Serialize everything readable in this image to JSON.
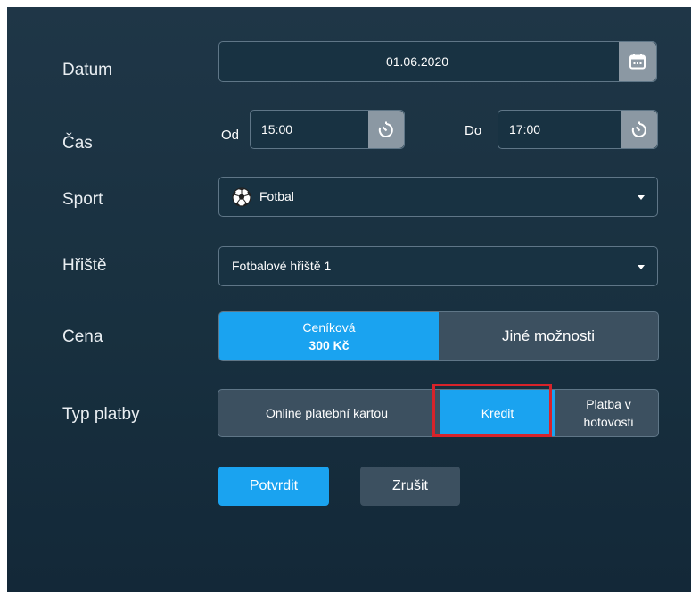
{
  "form": {
    "date": {
      "label": "Datum",
      "value": "01.06.2020",
      "icon": "calendar-icon"
    },
    "time": {
      "label": "Čas",
      "from_label": "Od",
      "from_value": "15:00",
      "to_label": "Do",
      "to_value": "17:00",
      "icon": "timer-icon"
    },
    "sport": {
      "label": "Sport",
      "value": "Fotbal",
      "icon": "soccer-ball-icon"
    },
    "field": {
      "label": "Hřiště",
      "value": "Fotbalové hřiště 1"
    },
    "price": {
      "label": "Cena",
      "options": [
        {
          "line1": "Ceníková",
          "line2": "300 Kč",
          "selected": true
        },
        {
          "line1": "Jiné možnosti",
          "selected": false
        }
      ]
    },
    "payment": {
      "label": "Typ platby",
      "options": [
        {
          "label": "Online platební kartou",
          "selected": false
        },
        {
          "label": "Kredit",
          "selected": true,
          "highlighted": true
        },
        {
          "line1": "Platba v",
          "line2": "hotovosti",
          "selected": false
        }
      ]
    },
    "actions": {
      "confirm": "Potvrdit",
      "cancel": "Zrušit"
    }
  },
  "colors": {
    "accent": "#1aa3f0",
    "background": "#1b3344",
    "segment_inactive": "#3c5060",
    "highlight_border": "#d8232a"
  }
}
